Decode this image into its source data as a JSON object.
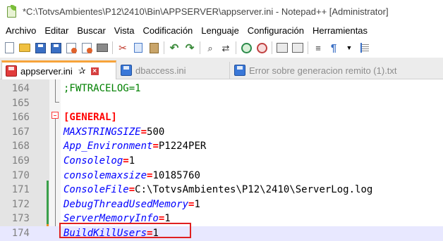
{
  "window": {
    "title": "*C:\\TotvsAmbientes\\P12\\2410\\Bin\\APPSERVER\\appserver.ini - Notepad++ [Administrator]"
  },
  "menu": [
    "Archivo",
    "Editar",
    "Buscar",
    "Vista",
    "Codificación",
    "Lenguaje",
    "Configuración",
    "Herramientas"
  ],
  "tabs": [
    {
      "label": "appserver.ini",
      "active": true,
      "icon": "disk-red-icon"
    },
    {
      "label": "dbaccess.ini",
      "active": false,
      "icon": "disk-blue-icon"
    },
    {
      "label": "Error sobre generacion remito (1).txt",
      "active": false,
      "icon": "disk-blue-icon"
    }
  ],
  "editor": {
    "lines": [
      {
        "num": "164",
        "key": ";FWTRACELOG=1",
        "eq": "",
        "value": "",
        "kind": "comment"
      },
      {
        "num": "165",
        "key": "",
        "eq": "",
        "value": "",
        "kind": "blank"
      },
      {
        "num": "166",
        "key": "[GENERAL]",
        "eq": "",
        "value": "",
        "kind": "section"
      },
      {
        "num": "167",
        "key": "MAXSTRINGSIZE",
        "eq": "=",
        "value": "500",
        "kind": "kv"
      },
      {
        "num": "168",
        "key": "App_Environment",
        "eq": "=",
        "value": "P1224PER",
        "kind": "kv"
      },
      {
        "num": "169",
        "key": "Consolelog",
        "eq": "=",
        "value": "1",
        "kind": "kv"
      },
      {
        "num": "170",
        "key": "consolemaxsize",
        "eq": "=",
        "value": "10185760",
        "kind": "kv"
      },
      {
        "num": "171",
        "key": "ConsoleFile",
        "eq": "=",
        "value": "C:\\TotvsAmbientes\\P12\\2410\\ServerLog.log",
        "kind": "kv"
      },
      {
        "num": "172",
        "key": "DebugThreadUsedMemory",
        "eq": "=",
        "value": "1",
        "kind": "kv"
      },
      {
        "num": "173",
        "key": "ServerMemoryInfo",
        "eq": "=",
        "value": "1",
        "kind": "kv"
      },
      {
        "num": "174",
        "key": "BuildKillUsers",
        "eq": "=",
        "value": "1",
        "kind": "kv"
      }
    ],
    "current_line": "174",
    "highlighted_line": "174"
  },
  "colors": {
    "keyword": "#0000ff",
    "operator": "#ff0000",
    "comment": "#008000",
    "saved_change": "#3aa04a",
    "unsaved_change": "#f08c1e",
    "highlight": "#e02020",
    "active_tab_accent": "#f7a33a"
  }
}
